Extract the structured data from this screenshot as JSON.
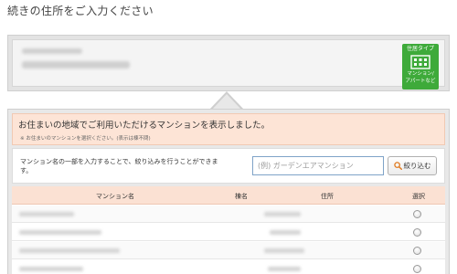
{
  "page": {
    "heading": "続きの住所をご入力ください"
  },
  "address_panel": {
    "type_badge": {
      "title": "住居タイプ",
      "icon": "apartment-building-icon",
      "label_line1": "マンション/",
      "label_line2": "アパートなど",
      "color": "#3eaa3a"
    }
  },
  "results": {
    "notice_title": "お住まいの地域でご利用いただけるマンションを表示しました。",
    "notice_sub": "※ お住まいのマンションを選択ください。(表示は棟不問)",
    "notice_bg": "#fde4d6",
    "search": {
      "description": "マンション名の一部を入力することで、絞り込みを行うことができます。",
      "placeholder": "(例) ガーデンエアマンション",
      "button_label": "絞り込む",
      "button_icon": "search-icon"
    },
    "table": {
      "headers": {
        "name": "マンション名",
        "building": "棟名",
        "address": "住所",
        "select": "選択"
      },
      "row_count": 4
    }
  }
}
